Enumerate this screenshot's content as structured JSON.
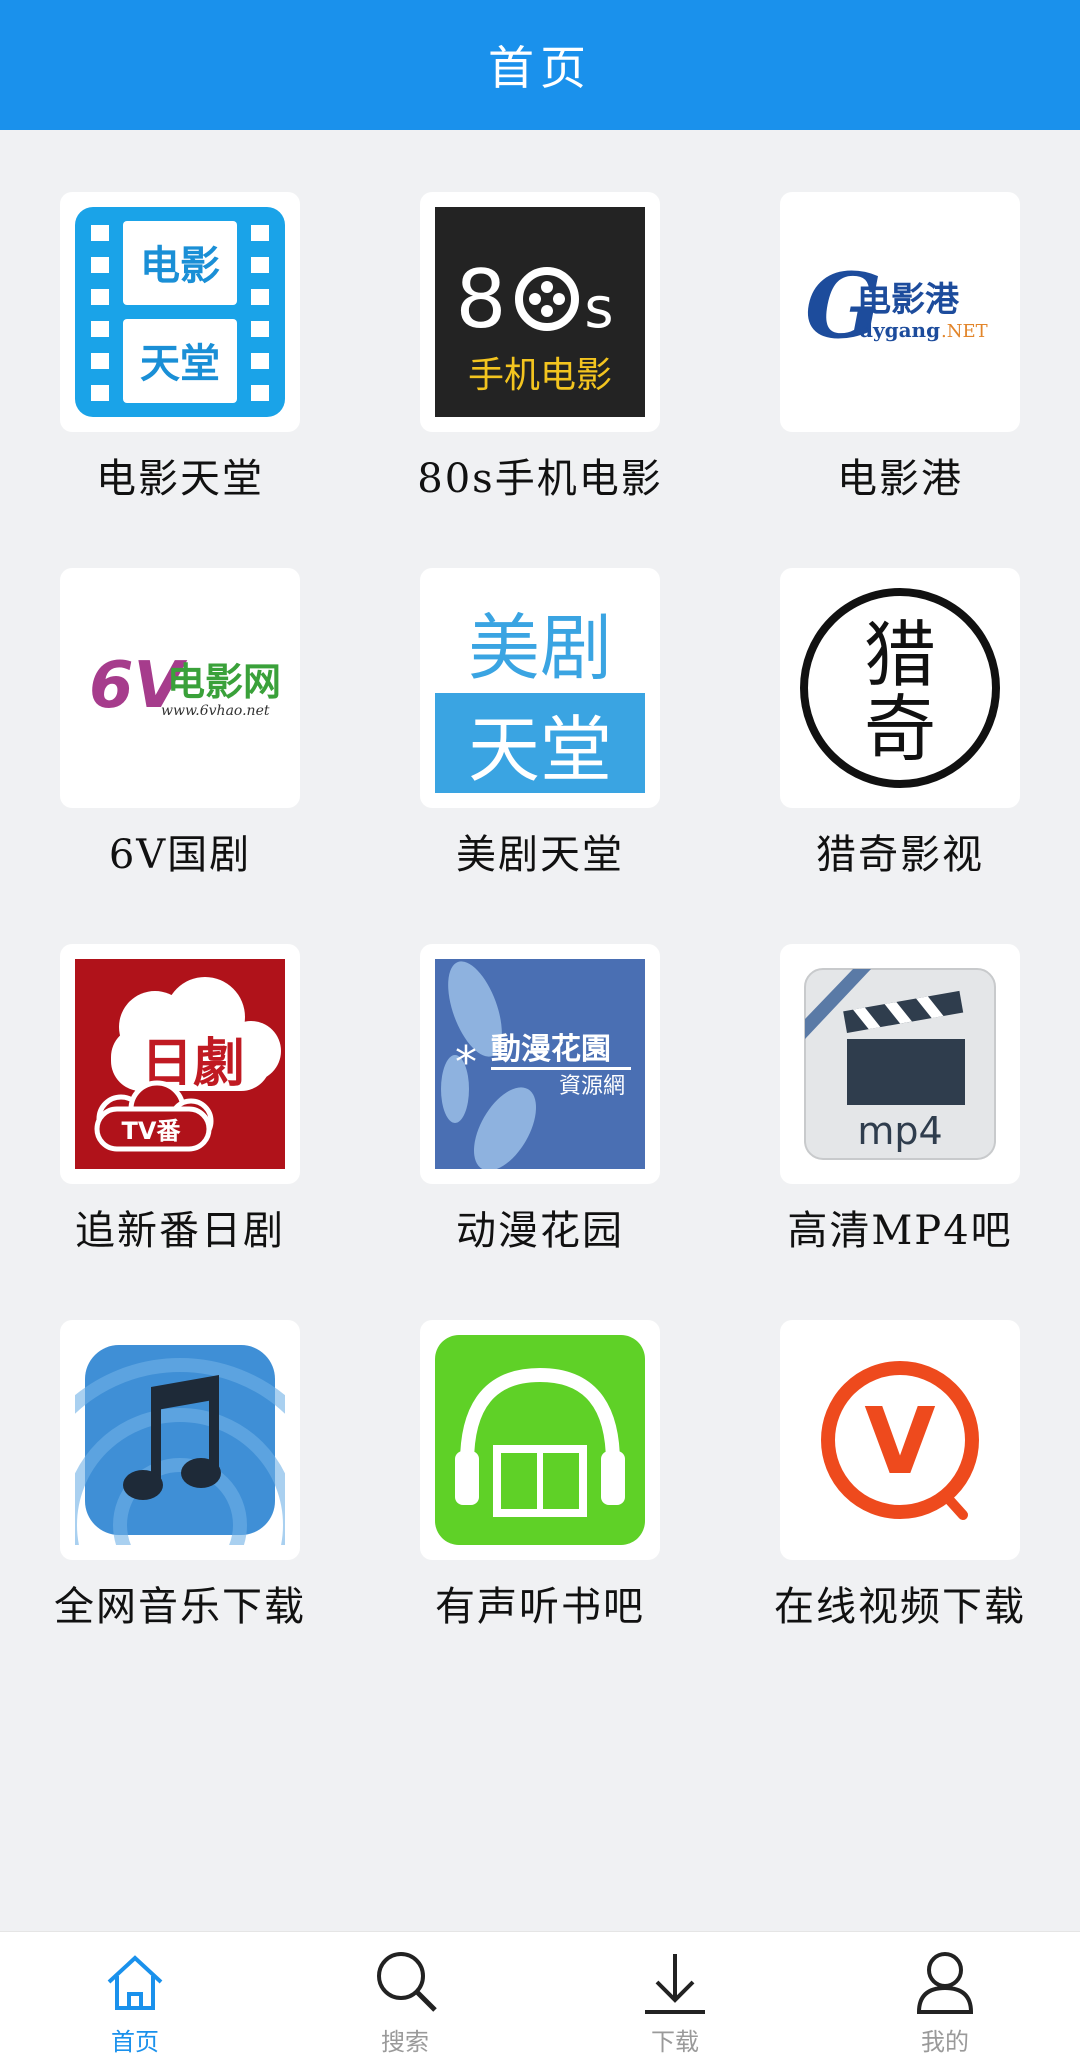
{
  "header": {
    "title": "首页"
  },
  "apps": [
    {
      "label": "电影天堂",
      "icon": "dianying-tiantang-logo",
      "logo_text": [
        "电影",
        "天堂"
      ]
    },
    {
      "label": "80s手机电影",
      "icon": "80s-logo",
      "logo_text": [
        "8",
        "s",
        "手机电影"
      ]
    },
    {
      "label": "电影港",
      "icon": "dygang-logo",
      "logo_text": [
        "电影港",
        "dygang",
        ".NET"
      ]
    },
    {
      "label": "6V国剧",
      "icon": "6v-logo",
      "logo_text": [
        "6V",
        "电影网",
        "www.6vhao.net"
      ]
    },
    {
      "label": "美剧天堂",
      "icon": "meiju-tiantang-logo",
      "logo_text": [
        "美剧",
        "天堂"
      ]
    },
    {
      "label": "猎奇影视",
      "icon": "lieqi-logo",
      "logo_text": [
        "猎",
        "奇"
      ]
    },
    {
      "label": "追新番日剧",
      "icon": "riju-cloud-logo",
      "logo_text": [
        "日劇",
        "TV番"
      ]
    },
    {
      "label": "动漫花园",
      "icon": "dongman-huayuan-logo",
      "logo_text": [
        "動漫花園",
        "資源網"
      ]
    },
    {
      "label": "高清MP4吧",
      "icon": "mp4-clapper-logo",
      "logo_text": [
        "mp4"
      ]
    },
    {
      "label": "全网音乐下载",
      "icon": "music-note-logo",
      "logo_text": []
    },
    {
      "label": "有声听书吧",
      "icon": "headphones-book-logo",
      "logo_text": []
    },
    {
      "label": "在线视频下载",
      "icon": "v-download-logo",
      "logo_text": [
        "V"
      ]
    }
  ],
  "tabbar": [
    {
      "label": "首页",
      "icon": "home-icon",
      "active": true
    },
    {
      "label": "搜索",
      "icon": "search-icon",
      "active": false
    },
    {
      "label": "下载",
      "icon": "download-icon",
      "active": false
    },
    {
      "label": "我的",
      "icon": "user-icon",
      "active": false
    }
  ],
  "colors": {
    "primary": "#1a91ec",
    "background": "#f0f1f3",
    "tab_inactive": "#9a9a9a"
  }
}
